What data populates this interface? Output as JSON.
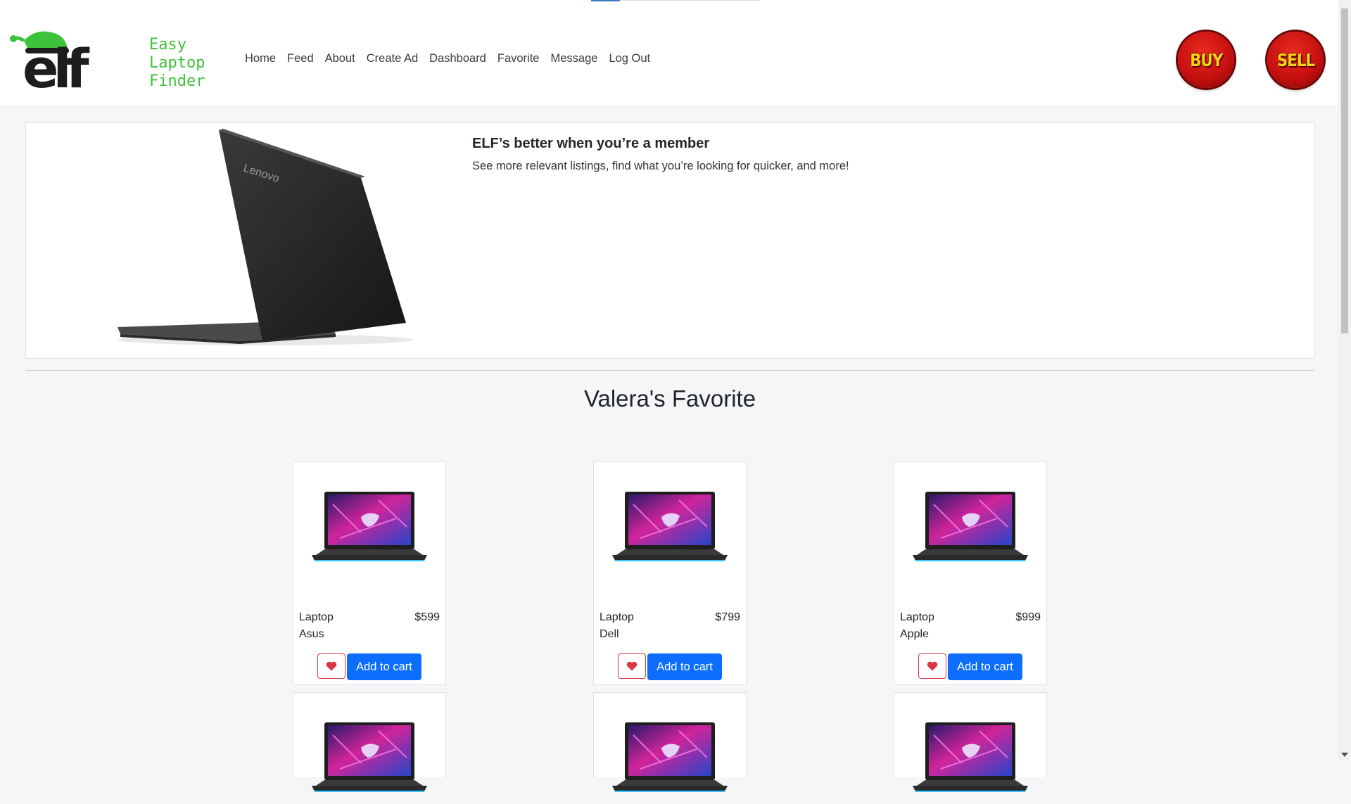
{
  "header": {
    "logo": {
      "mark": "elf",
      "line1": "Easy",
      "line2": "Laptop",
      "line3": "Finder"
    },
    "nav": [
      "Home",
      "Feed",
      "About",
      "Create Ad",
      "Dashboard",
      "Favorite",
      "Message",
      "Log Out"
    ],
    "buy_label": "BUY",
    "sell_label": "SELL",
    "page_load_progress": 0.17
  },
  "hero": {
    "laptop_brand": "Lenovo",
    "title": "ELF’s better when you’re a member",
    "subtitle": "See more relevant listings, find what you’re looking for quicker, and more!"
  },
  "favorites": {
    "title": "Valera's Favorite",
    "cart_label": "Add to cart",
    "items": [
      {
        "name": "Laptop",
        "brand": "Asus",
        "price": "$599"
      },
      {
        "name": "Laptop",
        "brand": "Dell",
        "price": "$799"
      },
      {
        "name": "Laptop",
        "brand": "Apple",
        "price": "$999"
      }
    ]
  },
  "colors": {
    "accent": "#0d6efd",
    "favorite": "#dc3545",
    "logo_green": "#3ec23a",
    "buy_sell_red": "#c81010",
    "buy_sell_text": "#f5d312"
  },
  "icons": [
    "heart-icon",
    "laptop-image",
    "elf-logo"
  ]
}
